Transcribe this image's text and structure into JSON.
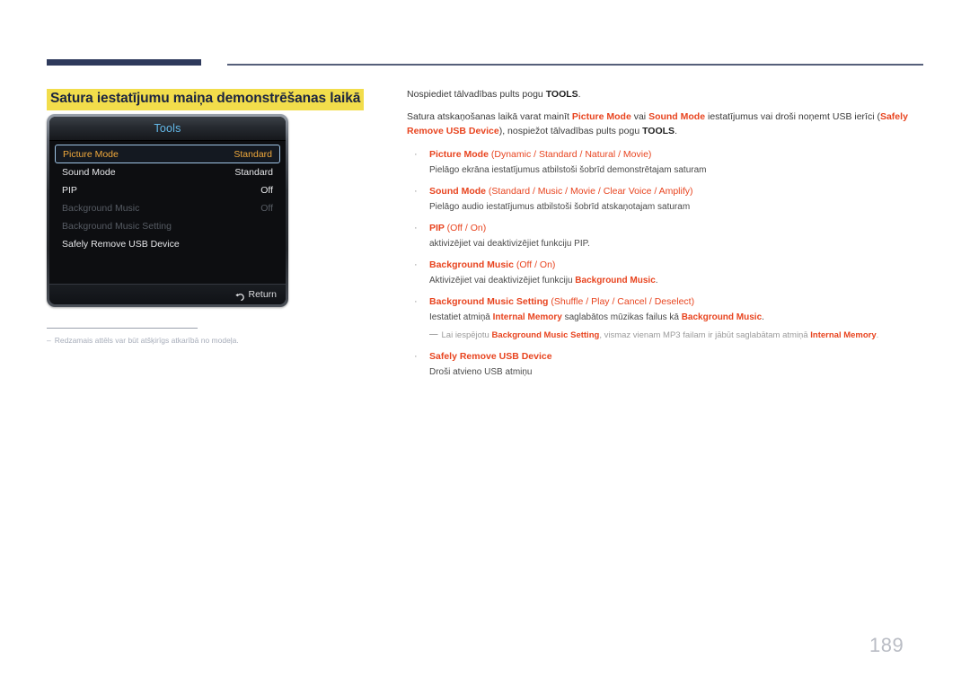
{
  "section": {
    "title": "Satura iestatījumu maiņa demonstrēšanas laikā"
  },
  "osd": {
    "header_title": "Tools",
    "rows": [
      {
        "label": "Picture Mode",
        "value": "Standard",
        "state": "selected"
      },
      {
        "label": "Sound Mode",
        "value": "Standard",
        "state": "normal"
      },
      {
        "label": "PIP",
        "value": "Off",
        "state": "normal"
      },
      {
        "label": "Background Music",
        "value": "Off",
        "state": "disabled"
      },
      {
        "label": "Background Music Setting",
        "value": "",
        "state": "disabled"
      },
      {
        "label": "Safely Remove USB Device",
        "value": "",
        "state": "normal"
      }
    ],
    "footer_label": "Return",
    "footer_icon": "return-arrow-icon"
  },
  "footnote": {
    "dash": "–",
    "text": "Redzamais attēls var būt atšķirīgs atkarībā no modeļa."
  },
  "content": {
    "para1": {
      "t1": "Nospiediet tālvadības pults pogu ",
      "b1": "TOOLS",
      "t2": "."
    },
    "para2": {
      "t1": "Satura atskaņošanas laikā varat mainīt ",
      "r1": "Picture Mode",
      "t2": " vai ",
      "r2": "Sound Mode",
      "t3": " iestatījumus vai droši noņemt USB ierīci (",
      "r3": "Safely Remove USB Device",
      "t4": "), nospiežot tālvadības pults pogu ",
      "b1": "TOOLS",
      "t5": "."
    },
    "bullet_dot": "·",
    "bullets": [
      {
        "name": "Picture Mode",
        "options": "(Dynamic / Standard / Natural / Movie)",
        "desc": "Pielāgo ekrāna iestatījumus atbilstoši šobrīd demonstrētajam saturam"
      },
      {
        "name": "Sound Mode",
        "options": "(Standard / Music / Movie / Clear Voice / Amplify)",
        "desc": "Pielāgo audio iestatījumus atbilstoši šobrīd atskaņotajam saturam"
      },
      {
        "name": "PIP",
        "options": "(Off / On)",
        "desc": "aktivizējiet vai deaktivizējiet funkciju PIP."
      },
      {
        "name": "Background Music",
        "options": "(Off / On)",
        "desc_t1": "Aktivizējiet vai deaktivizējiet funkciju ",
        "desc_r1": "Background Music",
        "desc_t2": "."
      },
      {
        "name": "Background Music Setting",
        "options": "(Shuffle / Play / Cancel / Deselect)",
        "desc_t1": "Iestatiet atmiņā ",
        "desc_r1": "Internal Memory",
        "desc_t2": " saglabātos mūzikas failus kā ",
        "desc_r2": "Background Music",
        "desc_t3": "."
      },
      {
        "name": "Safely Remove USB Device",
        "options": "",
        "desc": "Droši atvieno USB atmiņu"
      }
    ],
    "subnote": {
      "dash": "—",
      "t1": "Lai iespējotu ",
      "r1": "Background Music Setting",
      "t2": ", vismaz vienam MP3 failam ir jābūt saglabātam atmiņā ",
      "r2": "Internal Memory",
      "t3": "."
    }
  },
  "page_number": "189",
  "colors": {
    "accent_red": "#e8441f",
    "highlight_yellow": "#f2dd4b",
    "rule_navy": "#2e3a5c",
    "osd_selected_text": "#f0a93c",
    "osd_title_blue": "#63b8e8"
  }
}
